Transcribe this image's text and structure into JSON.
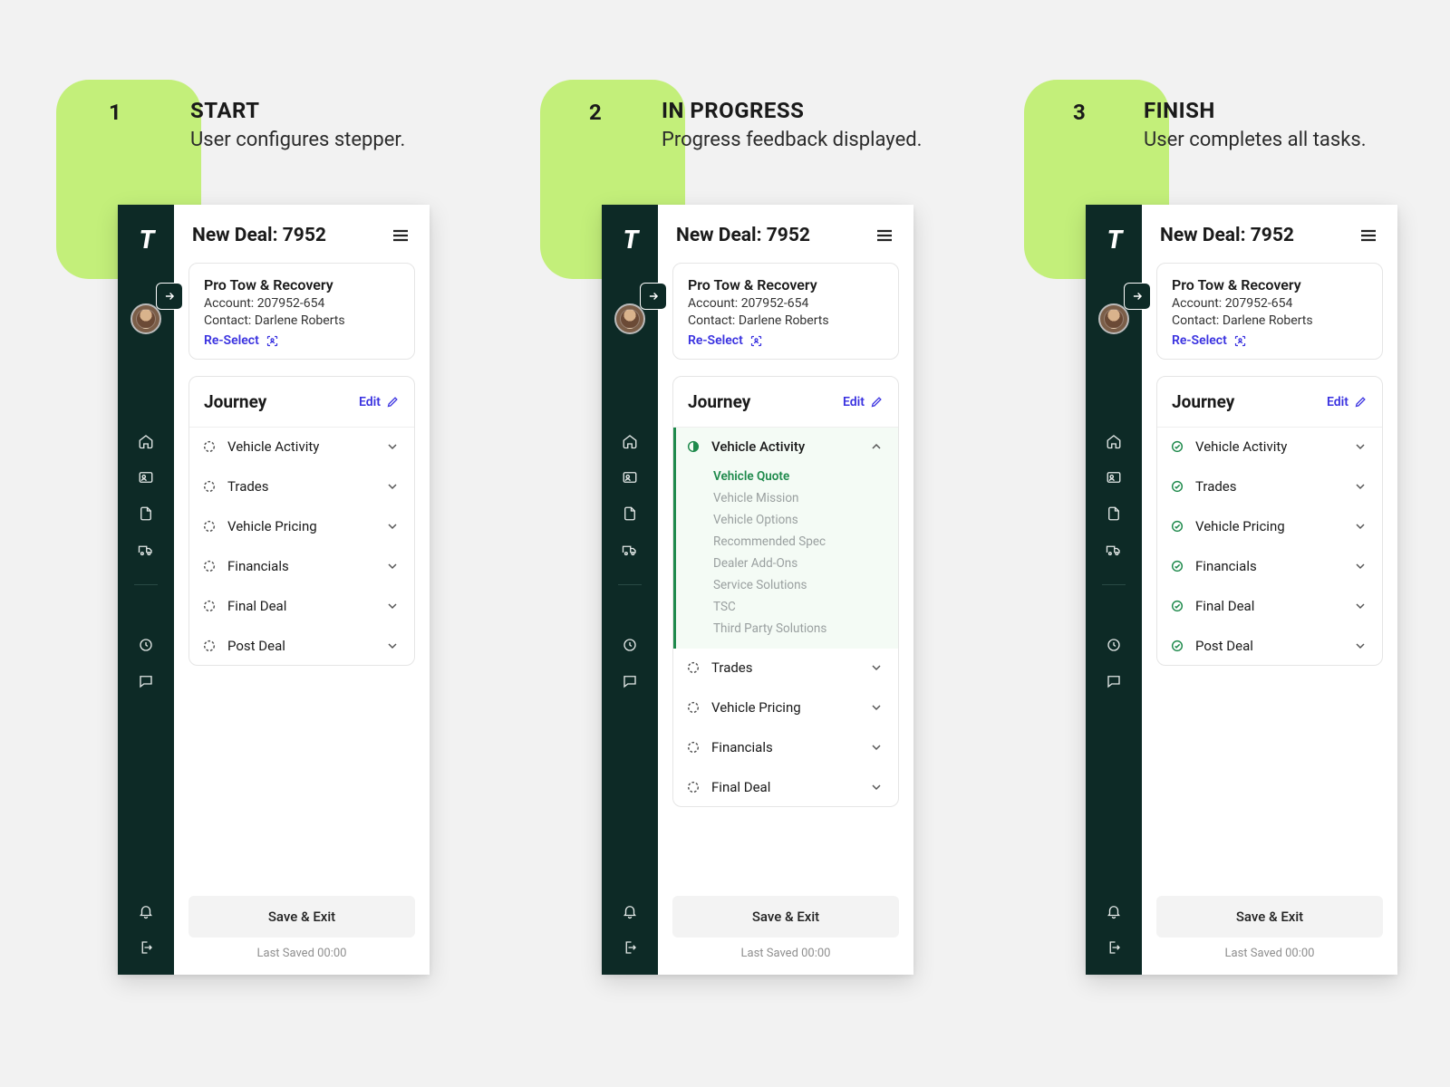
{
  "steps": [
    {
      "num": "1",
      "title": "START",
      "sub": "User configures stepper."
    },
    {
      "num": "2",
      "title": "IN PROGRESS",
      "sub": "Progress feedback displayed."
    },
    {
      "num": "3",
      "title": "FINISH",
      "sub": "User completes all tasks."
    }
  ],
  "header": {
    "title_prefix": "New Deal:",
    "deal_id": "7952"
  },
  "info": {
    "name": "Pro Tow & Recovery",
    "account_label": "Account:",
    "account": "207952-654",
    "contact_label": "Contact:",
    "contact": "Darlene Roberts",
    "reselect": "Re-Select"
  },
  "journey": {
    "title": "Journey",
    "edit": "Edit",
    "items": [
      "Vehicle Activity",
      "Trades",
      "Vehicle Pricing",
      "Financials",
      "Final Deal",
      "Post Deal"
    ],
    "sub_items": [
      "Vehicle Quote",
      "Vehicle Mission",
      "Vehicle Options",
      "Recommended Spec",
      "Dealer Add-Ons",
      "Service Solutions",
      "TSC",
      "Third Party Solutions"
    ]
  },
  "footer": {
    "save": "Save & Exit",
    "last_saved": "Last Saved 00:00"
  },
  "colors": {
    "accent_green": "#c3ef7a",
    "dark_teal": "#0d2a26",
    "link_blue": "#3a32e0",
    "success": "#1f8a4c"
  }
}
